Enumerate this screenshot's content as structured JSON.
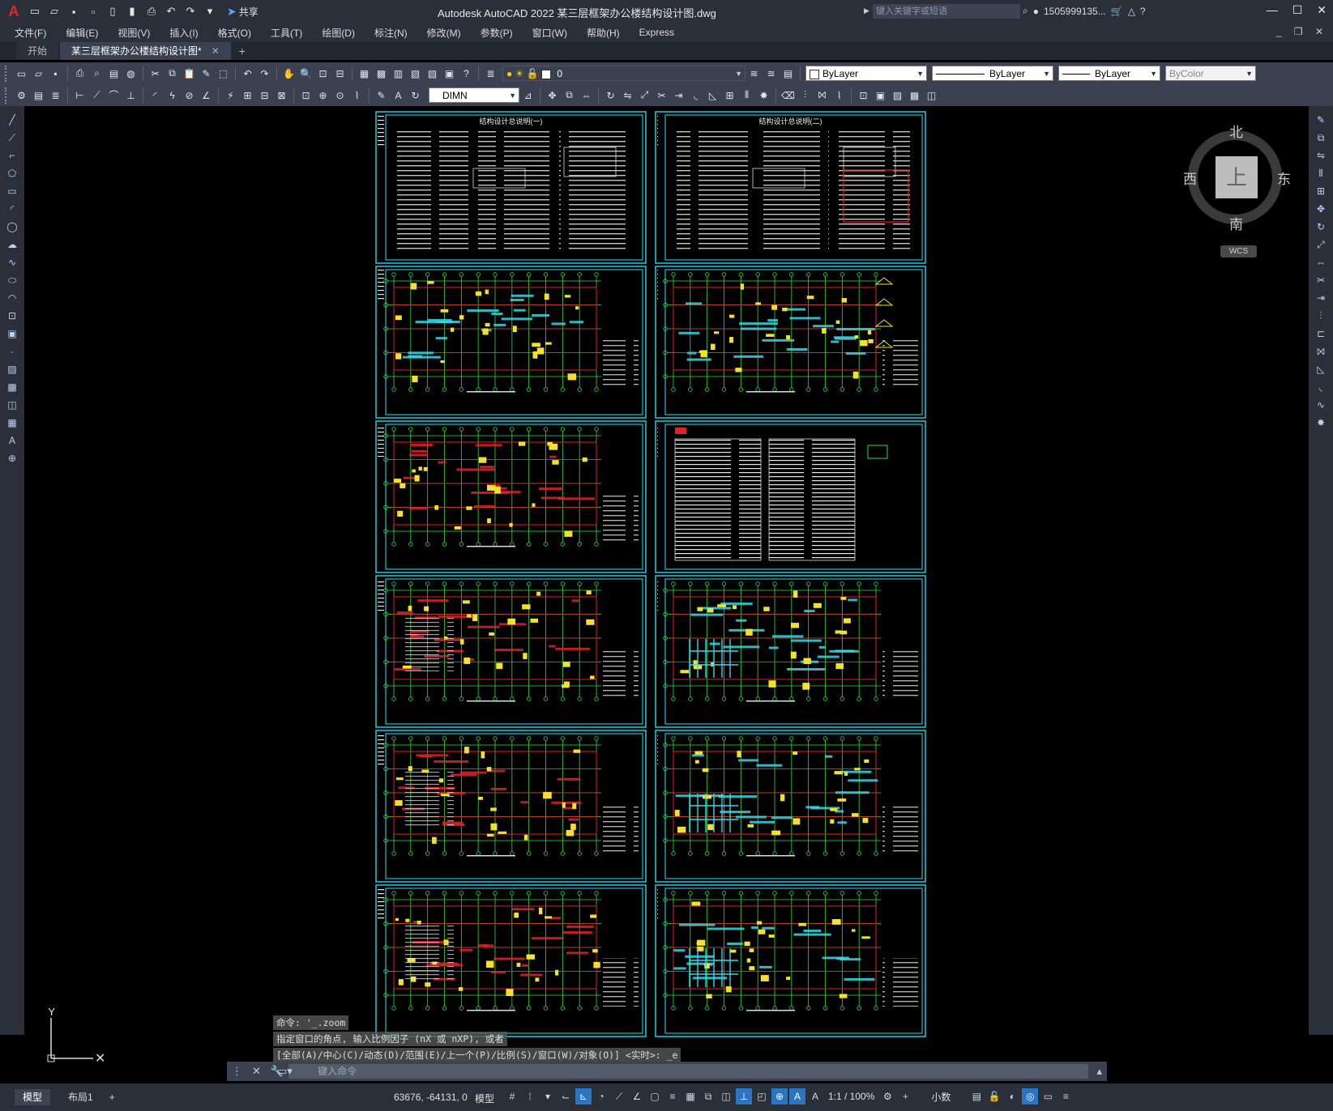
{
  "titlebar": {
    "app_title": "Autodesk AutoCAD 2022    某三层框架办公楼结构设计图.dwg",
    "share_label": "共享",
    "search_placeholder": "键入关键字或短语",
    "user_name": "1505999135..."
  },
  "menu": {
    "items": [
      "文件(F)",
      "编辑(E)",
      "视图(V)",
      "插入(I)",
      "格式(O)",
      "工具(T)",
      "绘图(D)",
      "标注(N)",
      "修改(M)",
      "参数(P)",
      "窗口(W)",
      "帮助(H)",
      "Express"
    ]
  },
  "tabs": {
    "start_label": "开始",
    "doc_label": "某三层框架办公楼结构设计图*",
    "new_tab": "+"
  },
  "toolbar": {
    "layer_value": "0",
    "color_value": "ByLayer",
    "linetype_value": "ByLayer",
    "lineweight_value": "ByLayer",
    "plotstyle_value": "ByColor",
    "dimstyle_value": "DIMN"
  },
  "viewcube": {
    "north": "北",
    "south": "南",
    "east": "东",
    "west": "西",
    "face": "上",
    "wcs": "WCS"
  },
  "ucs": {
    "y": "Y"
  },
  "sheets": {
    "sheet1_title": "结构设计总说明(一)",
    "sheet2_title": "结构设计总说明(二)"
  },
  "command": {
    "history": [
      "命令: '_.zoom",
      "指定窗口的角点, 输入比例因子 (nX 或 nXP), 或者",
      "[全部(A)/中心(C)/动态(D)/范围(E)/上一个(P)/比例(S)/窗口(W)/对象(O)] <实时>: _e"
    ],
    "placeholder": "键入命令"
  },
  "status": {
    "model_tab": "模型",
    "layout_tab": "布局1",
    "add_tab": "+",
    "coords": "63676, -64131, 0",
    "model_label": "模型",
    "scale": "1:1 / 100%",
    "units": "小数"
  },
  "colors": {
    "frame": "#19c2d6",
    "axis_green": "#2ee03a",
    "beam_red": "#e0212a",
    "yellow": "#f5e12a",
    "cyan": "#3ad6e6",
    "accent": "#2a74c0"
  }
}
